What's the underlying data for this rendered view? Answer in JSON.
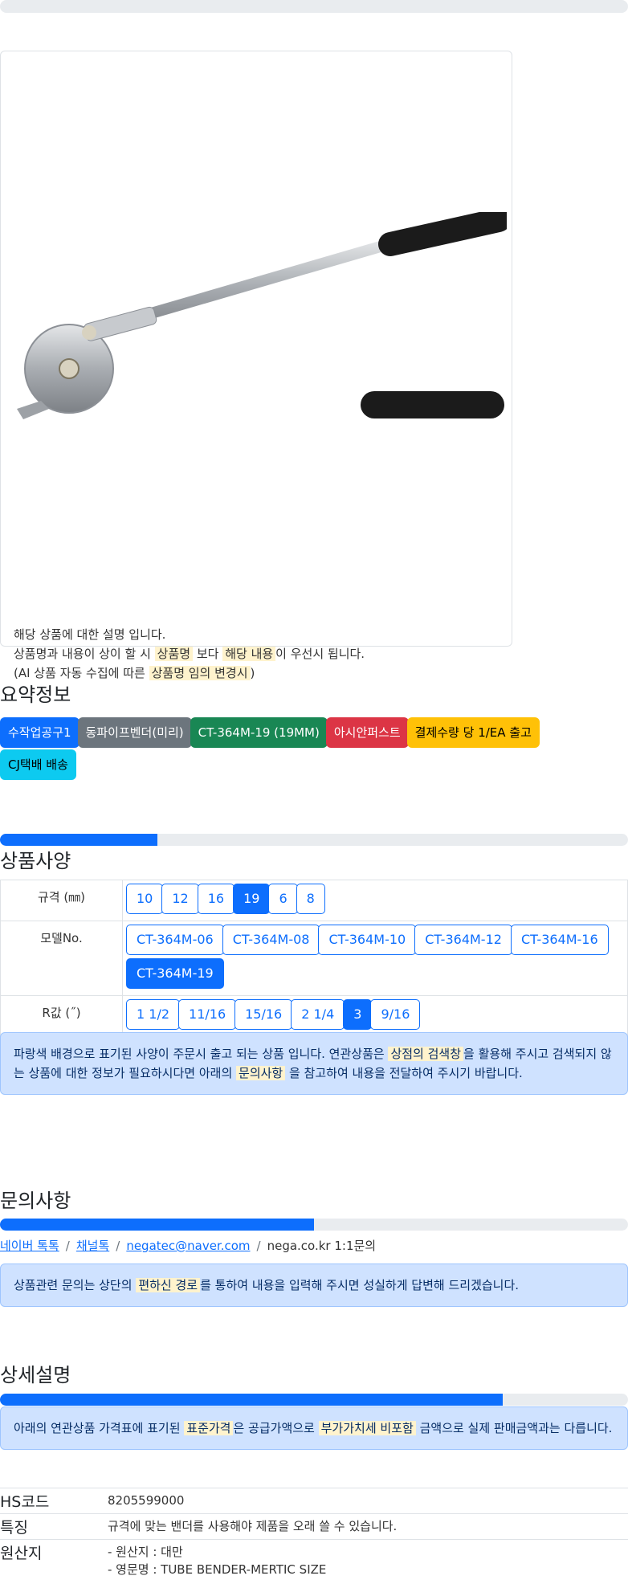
{
  "product": {
    "description": [
      {
        "parts": [
          {
            "text": "해당 상품에 대한 설명 입니다.",
            "hl": false
          }
        ]
      },
      {
        "parts": [
          {
            "text": "상품명과 내용이 상이 할 시 ",
            "hl": false
          },
          {
            "text": "상품명",
            "hl": true
          },
          {
            "text": " 보다 ",
            "hl": false
          },
          {
            "text": "해당 내용",
            "hl": true
          },
          {
            "text": "이 우선시 됩니다.",
            "hl": false
          }
        ]
      },
      {
        "parts": [
          {
            "text": "(AI 상품 자동 수집에 따른 ",
            "hl": false
          },
          {
            "text": "상품명 임의 변경시",
            "hl": true
          },
          {
            "text": ")",
            "hl": false
          }
        ]
      }
    ]
  },
  "summary": {
    "title": "요약정보",
    "badges": [
      {
        "label": "수작업공구1",
        "color": "blue"
      },
      {
        "label": "동파이프벤더(미리)",
        "color": "gray"
      },
      {
        "label": "CT-364M-19 (19MM)",
        "color": "green"
      },
      {
        "label": "아시안퍼스트",
        "color": "red"
      },
      {
        "label": "결제수량 당 1/EA 출고",
        "color": "yellow"
      },
      {
        "label": "CJ택배 배송",
        "color": "cyan"
      }
    ]
  },
  "specs": {
    "progress": 0.25,
    "title": "상품사양",
    "rows": [
      {
        "label": "규격 (㎜)",
        "options": [
          "10",
          "12",
          "16",
          "19",
          "6",
          "8"
        ],
        "selected": "19"
      },
      {
        "label": "모델No.",
        "options": [
          "CT-364M-06",
          "CT-364M-08",
          "CT-364M-10",
          "CT-364M-12",
          "CT-364M-16",
          "CT-364M-19"
        ],
        "selected": "CT-364M-19"
      },
      {
        "label": "R값 (˝)",
        "options": [
          "1 1/2",
          "11/16",
          "15/16",
          "2 1/4",
          "3",
          "9/16"
        ],
        "selected": "3"
      }
    ],
    "notice": [
      {
        "text": "파랑색 배경으로 표기된 사양이 주문시 출고 되는 상품 입니다. 연관상품은 ",
        "hl": false
      },
      {
        "text": "상점의 검색창",
        "hl": true
      },
      {
        "text": "을 활용해 주시고 검색되지 않는 상품에 대한 정보가 필요하시다면 아래의 ",
        "hl": false
      },
      {
        "text": "문의사항",
        "hl": true
      },
      {
        "text": " 을 참고하여 내용을 전달하여 주시기 바랍니다.",
        "hl": false
      }
    ]
  },
  "inquiry": {
    "title": "문의사항",
    "progress": 0.5,
    "links": [
      "네이버 톡톡",
      "채널톡",
      "negatec@naver.com"
    ],
    "plain": "nega.co.kr 1:1문의",
    "notice": [
      {
        "text": "상품관련 문의는 상단의 ",
        "hl": false
      },
      {
        "text": "편하신 경로",
        "hl": true
      },
      {
        "text": "를 통하여 내용을 입력해 주시면 성실하게 답변해 드리겠습니다.",
        "hl": false
      }
    ]
  },
  "detail": {
    "title": "상세설명",
    "progress": 0.8,
    "notice": [
      {
        "text": "아래의 연관상품 가격표에 표기된 ",
        "hl": false
      },
      {
        "text": "표준가격",
        "hl": true
      },
      {
        "text": "은 공급가액으로 ",
        "hl": false
      },
      {
        "text": "부가가치세 비포함",
        "hl": true
      },
      {
        "text": " 금액으로 실제 판매금액과는 다릅니다.",
        "hl": false
      }
    ],
    "info": [
      {
        "key": "HS코드",
        "values": [
          "8205599000"
        ]
      },
      {
        "key": "특징",
        "values": [
          "규격에 맞는 밴더를 사용해야 제품을 오래 쓸 수 있습니다."
        ]
      },
      {
        "key": "원산지",
        "values": [
          "- 원산지 : 대만",
          "- 영문명 : TUBE BENDER-MERTIC SIZE"
        ]
      }
    ]
  }
}
